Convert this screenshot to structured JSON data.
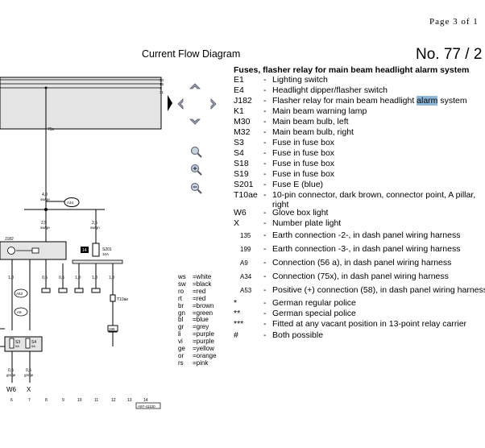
{
  "page": {
    "number_text": "Page 3 of 1"
  },
  "header": {
    "title": "Current Flow Diagram",
    "number": "No. 77 / 2"
  },
  "legend": {
    "heading": "Fuses, flasher relay for main beam headlight alarm system",
    "items": [
      {
        "code": "E1",
        "desc": "Lighting switch"
      },
      {
        "code": "E4",
        "desc": "Headlight dipper/flasher switch"
      },
      {
        "code": "J182",
        "desc_before": "Flasher relay for main beam headlight ",
        "desc_highlight": "alarm",
        "desc_after": " system"
      },
      {
        "code": "K1",
        "desc": "Main beam warning lamp"
      },
      {
        "code": "M30",
        "desc": "Main beam bulb, left"
      },
      {
        "code": "M32",
        "desc": "Main beam bulb, right"
      },
      {
        "code": "S3",
        "desc": "Fuse in fuse box"
      },
      {
        "code": "S4",
        "desc": "Fuse in fuse box"
      },
      {
        "code": "S18",
        "desc": "Fuse in fuse box"
      },
      {
        "code": "S19",
        "desc": "Fuse in fuse box"
      },
      {
        "code": "S201",
        "desc": "Fuse E (blue)"
      },
      {
        "code": "T10ae",
        "desc": "10-pin connector, dark brown, connector point, A pillar,",
        "desc2": "right"
      },
      {
        "code": "W6",
        "desc": "Glove box light"
      },
      {
        "code": "X",
        "desc": "Number plate light"
      },
      {
        "code": "135",
        "desc": "Earth connection -2-, in dash panel wiring harness"
      },
      {
        "code": "199",
        "desc": "Earth connection -3-, in dash panel wiring harness"
      },
      {
        "code": "A9",
        "desc": "Connection (56 a), in dash panel wiring harness"
      },
      {
        "code": "A34",
        "desc": "Connection (75x), in dash panel wiring harness"
      },
      {
        "code": "A53",
        "desc": "Positive (+) connection (58), in dash panel wiring harness"
      },
      {
        "code": "*",
        "desc": "German regular police"
      },
      {
        "code": "**",
        "desc": "German special police"
      },
      {
        "code": "***",
        "desc": "Fitted at any vacant position in 13-point relay carrier"
      },
      {
        "code": "#",
        "desc": "Both possible"
      }
    ]
  },
  "color_codes": [
    {
      "abbr": "ws",
      "name": "white"
    },
    {
      "abbr": "sw",
      "name": "black"
    },
    {
      "abbr": "ro",
      "name": "red"
    },
    {
      "abbr": "rt",
      "name": "red"
    },
    {
      "abbr": "br",
      "name": "brown"
    },
    {
      "abbr": "gn",
      "name": "green"
    },
    {
      "abbr": "bl",
      "name": "blue"
    },
    {
      "abbr": "gr",
      "name": "grey"
    },
    {
      "abbr": "li",
      "name": "purple"
    },
    {
      "abbr": "vi",
      "name": "purple"
    },
    {
      "abbr": "ge",
      "name": "yellow"
    },
    {
      "abbr": "or",
      "name": "orange"
    },
    {
      "abbr": "rs",
      "name": "pink"
    }
  ],
  "diagram": {
    "bus_labels": [
      "30",
      "15",
      "X",
      "31"
    ],
    "wire_labels": {
      "w75x": "75x",
      "w40": "4,0",
      "w40c": "sw/ge",
      "wA34": "A34",
      "w25a": "2,5",
      "w25ac": "sw/ge",
      "w25b": "2,5",
      "w25bc": "sw/gn",
      "wJ182": "J182",
      "wS201": "S201",
      "wS201a": "10A",
      "w15a": "1,0",
      "w05a": "0,5",
      "w05b": "0,5",
      "w15b": "1,0",
      "w10c": "1,0",
      "w10d": "1,0",
      "wT10": "T10ae",
      "wA53": "A53",
      "wA9": "A9",
      "wS3": "S3",
      "wS4": "S4",
      "w5A1": "5A",
      "w5A2": "5A",
      "w199": "199",
      "w135": "135",
      "wc1": "0,5",
      "wc2": "0,5",
      "wc1c": "gn/ge",
      "wc2c": "gn/ge",
      "tag14": "14"
    },
    "components": [
      "W6",
      "X"
    ],
    "track_numbers": [
      "6",
      "7",
      "8",
      "9",
      "10",
      "11",
      "12",
      "13",
      "14"
    ],
    "ref_code": "A97-41120"
  },
  "nav": {
    "icons": [
      "arrow-up-icon",
      "arrow-left-icon",
      "arrow-right-icon",
      "arrow-down-icon",
      "zoom-icon",
      "zoom-in-icon",
      "zoom-out-icon",
      "sidebar-toggle-icon"
    ]
  }
}
